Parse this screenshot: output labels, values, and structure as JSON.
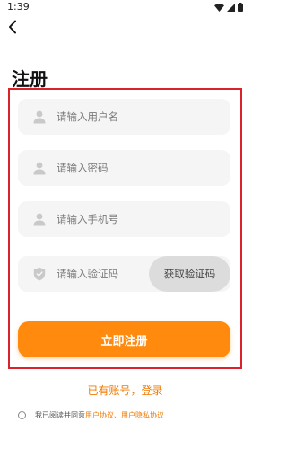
{
  "status_bar": {
    "time": "1:39",
    "icons": [
      "wifi-icon",
      "signal-icon",
      "battery-icon"
    ]
  },
  "header": {
    "back_icon": "chevron-left-icon",
    "title": "注册"
  },
  "form": {
    "username": {
      "placeholder": "请输入用户名",
      "value": "",
      "icon": "user-icon"
    },
    "password": {
      "placeholder": "请输入密码",
      "value": "",
      "icon": "user-icon"
    },
    "phone": {
      "placeholder": "请输入手机号",
      "value": "",
      "icon": "user-icon"
    },
    "code": {
      "placeholder": "请输入验证码",
      "value": "",
      "icon": "shield-icon",
      "button_label": "获取验证码"
    },
    "submit_label": "立即注册"
  },
  "footer": {
    "login_link": "已有账号，登录",
    "agreement_prefix": "我已阅读并同意",
    "agreement_links": "用户协议、用户隐私协议"
  },
  "colors": {
    "accent": "#ff8a0d",
    "link": "#f07a00",
    "highlight": "#d9222a",
    "field_bg": "#f5f5f5"
  }
}
